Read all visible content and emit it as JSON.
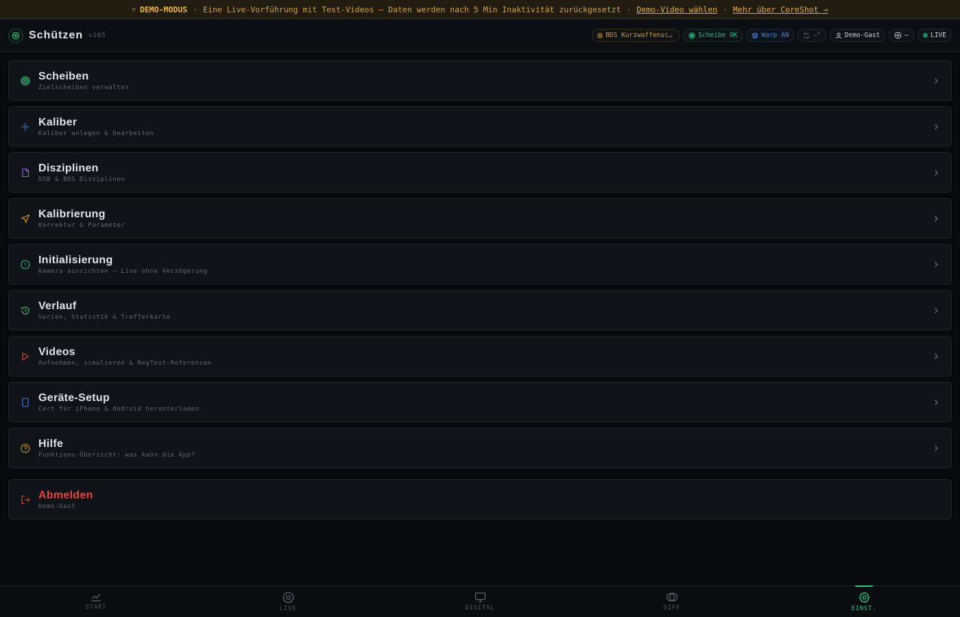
{
  "banner": {
    "mode": "DEMO-MODUS",
    "message": "Eine Live-Vorführung mit Test-Videos — Daten werden nach 5 Min Inaktivität zurückgesetzt",
    "link_demo": "Demo-Video wählen",
    "link_more": "Mehr über CoreShot →"
  },
  "header": {
    "title": "Schützen",
    "version": "v205",
    "chips": {
      "discipline": "BDS Kurzwaffenschießen",
      "target": "Scheibe OK",
      "warp": "Warp AN",
      "sync": "—°",
      "user": "Demo-Gast",
      "aim": "—",
      "live": "LIVE"
    }
  },
  "colors": {
    "accent": "#2fcf86",
    "warning": "#d99a2e",
    "info": "#3d86e6",
    "danger": "#e5453f"
  },
  "menu": [
    {
      "title": "Scheiben",
      "subtitle": "Zielscheiben verwalten",
      "icon": "target-icon"
    },
    {
      "title": "Kaliber",
      "subtitle": "Kaliber anlegen & bearbeiten",
      "icon": "crosshair-icon"
    },
    {
      "title": "Disziplinen",
      "subtitle": "DSB & BDS Disziplinen",
      "icon": "file-icon"
    },
    {
      "title": "Kalibrierung",
      "subtitle": "Korrektur & Parameter",
      "icon": "navigation-icon"
    },
    {
      "title": "Initialisierung",
      "subtitle": "Kamera ausrichten — Live ohne Verzögerung",
      "icon": "info-icon"
    },
    {
      "title": "Verlauf",
      "subtitle": "Serien, Statistik & Trefferkarte",
      "icon": "history-icon"
    },
    {
      "title": "Videos",
      "subtitle": "Aufnehmen, simulieren & RegTest-Referenzen",
      "icon": "play-icon"
    },
    {
      "title": "Geräte-Setup",
      "subtitle": "Cert für iPhone & Android herunterladen",
      "icon": "phone-icon"
    },
    {
      "title": "Hilfe",
      "subtitle": "Funktions-Übersicht: was kann die App?",
      "icon": "help-icon"
    }
  ],
  "logout": {
    "title": "Abmelden",
    "subtitle": "Demo-Gast",
    "icon": "logout-icon"
  },
  "bottom_nav": [
    {
      "label": "START",
      "icon": "chart-line-icon",
      "active": false
    },
    {
      "label": "LIVE",
      "icon": "target-icon",
      "active": false
    },
    {
      "label": "DIGITAL",
      "icon": "monitor-icon",
      "active": false
    },
    {
      "label": "DIFF",
      "icon": "overlap-circles-icon",
      "active": false
    },
    {
      "label": "EINST.",
      "icon": "gear-icon",
      "active": true
    }
  ]
}
